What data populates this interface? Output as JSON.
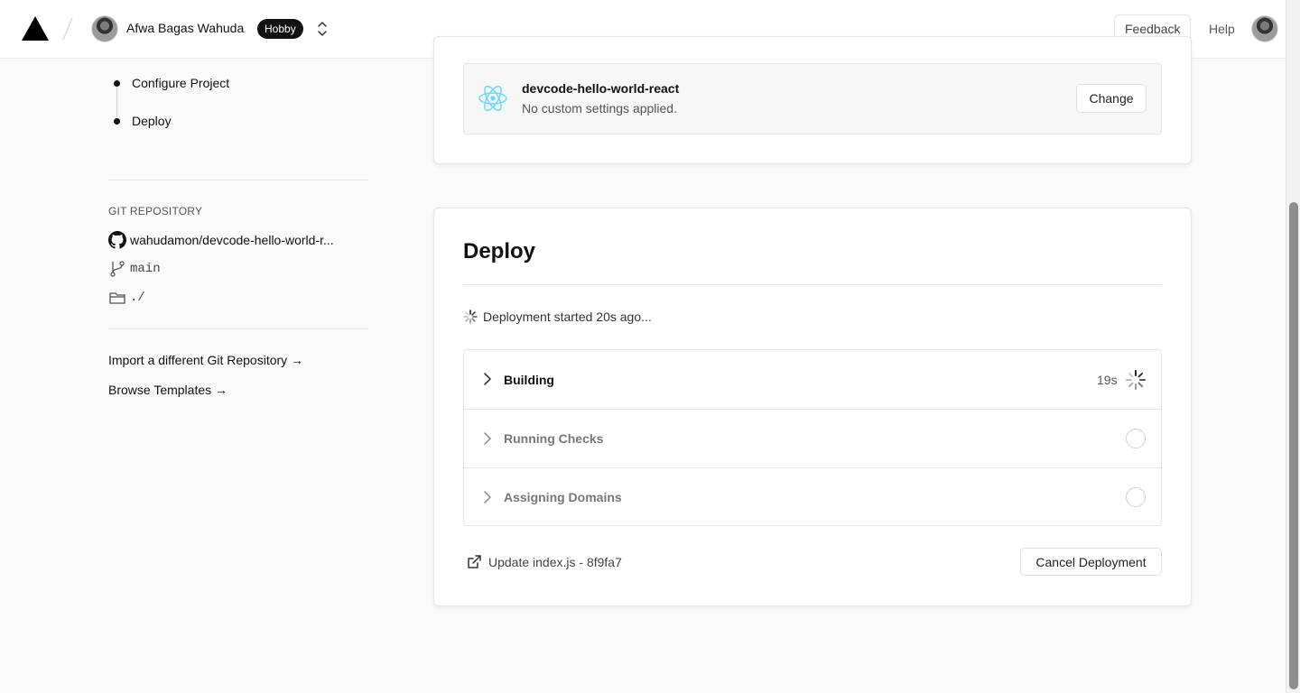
{
  "header": {
    "username": "Afwa Bagas Wahuda",
    "plan_badge": "Hobby",
    "feedback_label": "Feedback",
    "help_label": "Help"
  },
  "sidebar": {
    "steps": [
      {
        "label": "Configure Project"
      },
      {
        "label": "Deploy"
      }
    ],
    "git_section_label": "GIT REPOSITORY",
    "repo_name": "wahudamon/devcode-hello-world-r...",
    "branch": "main",
    "root_dir": "./",
    "import_link": "Import a different Git Repository →",
    "templates_link": "Browse Templates →"
  },
  "framework_card": {
    "project_name": "devcode-hello-world-react",
    "settings_text": "No custom settings applied.",
    "change_label": "Change"
  },
  "deploy_card": {
    "title": "Deploy",
    "status_text": "Deployment started 20s ago...",
    "phases": [
      {
        "label": "Building",
        "time": "19s",
        "state": "active"
      },
      {
        "label": "Running Checks",
        "state": "pending"
      },
      {
        "label": "Assigning Domains",
        "state": "pending"
      }
    ],
    "commit_text": "Update index.js - 8f9fa7",
    "cancel_label": "Cancel Deployment"
  },
  "colors": {
    "accent_react": "#61dafb",
    "badge_bg": "#111111"
  }
}
